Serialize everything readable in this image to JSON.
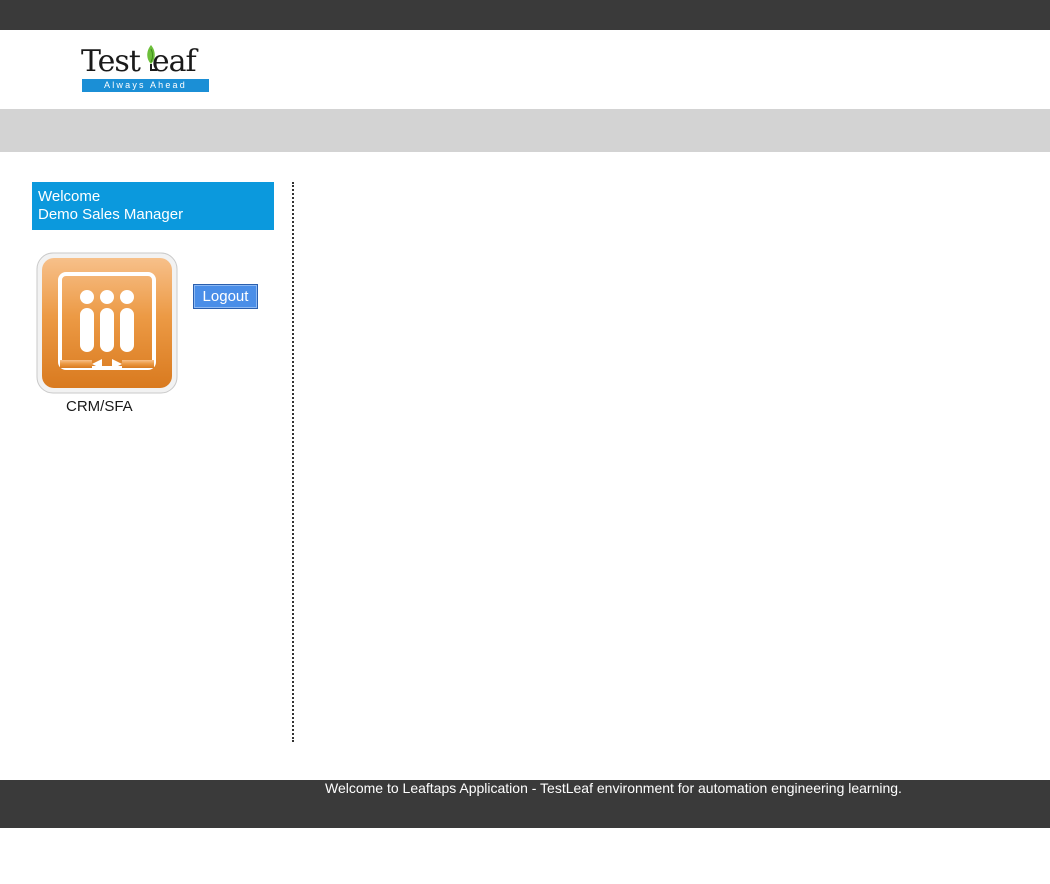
{
  "header": {
    "logo_text": "TestLeaf",
    "logo_tagline": "Always Ahead"
  },
  "welcome": {
    "greeting": "Welcome",
    "user_name": "Demo Sales Manager"
  },
  "apps": [
    {
      "label": "CRM/SFA",
      "icon": "crm-sfa-icon"
    }
  ],
  "actions": {
    "logout_label": "Logout"
  },
  "footer": {
    "text": "Welcome to Leaftaps Application - TestLeaf environment for automation engineering learning."
  },
  "colors": {
    "top_bar": "#3a3a3a",
    "nav_bar": "#d3d3d3",
    "welcome_bg": "#0b99dd",
    "logout_bg": "#4a8ee8",
    "app_icon_orange": "#e58a2b",
    "tagline_blue": "#1b8fd6"
  }
}
